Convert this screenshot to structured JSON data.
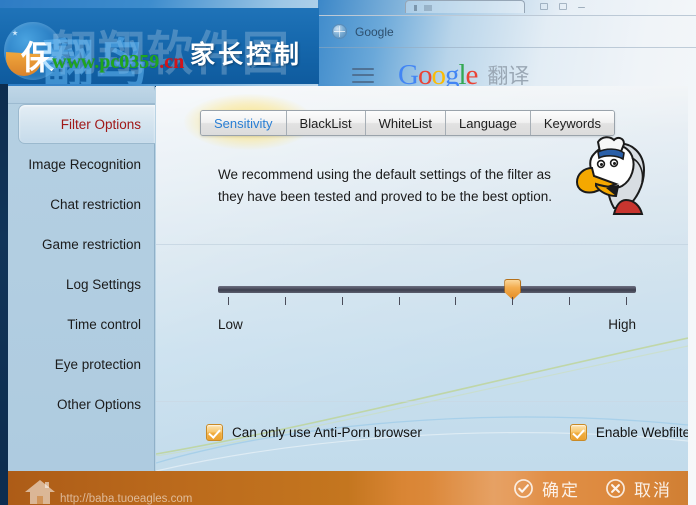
{
  "background": {
    "bookmark_label": "Google",
    "bookmark_icon": "globe-icon",
    "menu_icon": "hamburger-icon",
    "google_logo": {
      "g1": "G",
      "o1": "o",
      "o2": "o",
      "g2": "g",
      "l": "l",
      "e": "e"
    },
    "translate_label": "翻译"
  },
  "header": {
    "logo_letter": "保",
    "watermark_text": "翱翔软件园",
    "watermark_text2": "翻鸟",
    "watermark_url_main": "www.pc0359",
    "watermark_url_suffix": ".cn",
    "app_title": "家长控制"
  },
  "sidebar": {
    "items": [
      {
        "label": "Filter Options",
        "active": true
      },
      {
        "label": "Image Recognition",
        "active": false
      },
      {
        "label": "Chat restriction",
        "active": false
      },
      {
        "label": "Game restriction",
        "active": false
      },
      {
        "label": "Log Settings",
        "active": false
      },
      {
        "label": "Time control",
        "active": false
      },
      {
        "label": "Eye protection",
        "active": false
      },
      {
        "label": "Other Options",
        "active": false
      }
    ]
  },
  "content": {
    "tabs": [
      {
        "label": "Sensitivity",
        "active": true
      },
      {
        "label": "BlackList",
        "active": false
      },
      {
        "label": "WhiteList",
        "active": false
      },
      {
        "label": "Language",
        "active": false
      },
      {
        "label": "Keywords",
        "active": false
      }
    ],
    "recommend_text": "We recommend using the default settings of the filter as they have been tested and proved to be the best option.",
    "mascot_icon": "eagle-mascot-icon",
    "slider": {
      "label_low": "Low",
      "label_high": "High",
      "ticks": 8,
      "value_index": 6,
      "min": 1,
      "max": 8
    },
    "checkboxes": [
      {
        "label": "Can only use Anti-Porn browser",
        "checked": true
      },
      {
        "label": "Enable Webfilter",
        "checked": true
      }
    ]
  },
  "footer": {
    "home_icon": "home-icon",
    "url": "http://baba.tuoeagles.com",
    "ok_label": "确定",
    "ok_icon": "check-circle-icon",
    "cancel_label": "取消",
    "cancel_icon": "x-circle-icon"
  },
  "colors": {
    "header_blue": "#1668ad",
    "accent_orange": "#e38c24",
    "footer_orange": "#c4761f",
    "active_nav_red": "#a01818",
    "active_tab_blue": "#2a7fd4"
  }
}
